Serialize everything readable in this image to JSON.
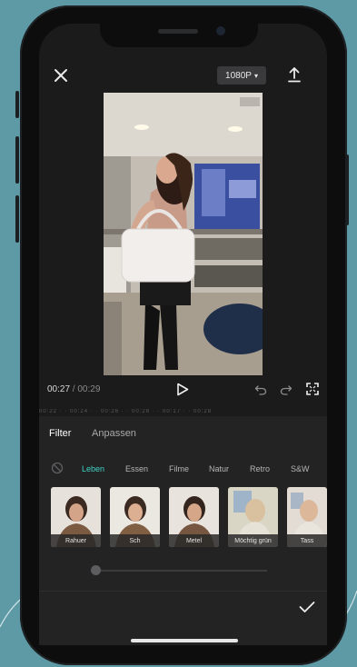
{
  "header": {
    "resolution_label": "1080P",
    "resolution_caret": "▾"
  },
  "player": {
    "current_time": "00:27",
    "separator": " / ",
    "duration": "00:29"
  },
  "timeline": {
    "ticks": "00:22 · · 00:24 · · 00:26 · · 00:28 · · 00:17 · · 00:28"
  },
  "panel": {
    "tabs": [
      {
        "label": "Filter",
        "active": true
      },
      {
        "label": "Anpassen",
        "active": false
      }
    ],
    "categories": [
      {
        "label": "Leben",
        "active": true
      },
      {
        "label": "Essen",
        "active": false
      },
      {
        "label": "Filme",
        "active": false
      },
      {
        "label": "Natur",
        "active": false
      },
      {
        "label": "Retro",
        "active": false
      },
      {
        "label": "S&W",
        "active": false
      }
    ],
    "filters": [
      {
        "label": "Rahuer"
      },
      {
        "label": "Sch"
      },
      {
        "label": "Metel"
      },
      {
        "label": "Möchtig grün"
      },
      {
        "label": "Tass"
      }
    ],
    "intensity": 0.0
  },
  "colors": {
    "accent": "#3fd3c3",
    "screen_bg": "#1b1b1c",
    "panel_bg": "#232324"
  },
  "icons": [
    "close-icon",
    "export-icon",
    "play-icon",
    "undo-icon",
    "redo-icon",
    "fullscreen-icon",
    "none-filter-icon",
    "check-icon"
  ]
}
